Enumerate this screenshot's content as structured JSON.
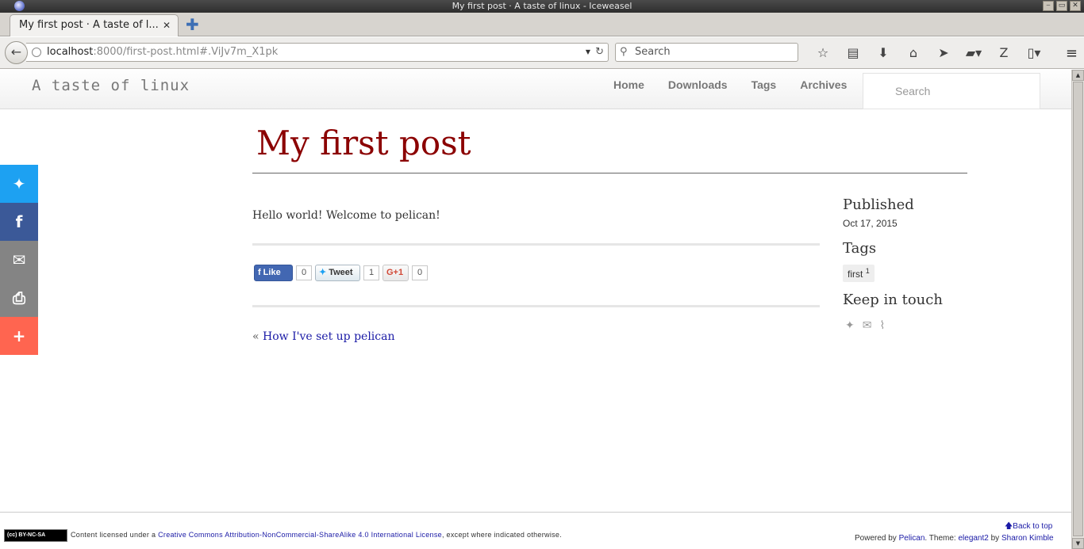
{
  "window": {
    "title": "My first post · A taste of linux - Iceweasel",
    "controls": [
      "⎯",
      "▭",
      "✕"
    ]
  },
  "tab": {
    "title": "My first post · A taste of l...",
    "close": "✕",
    "new_tab": "✚"
  },
  "nav": {
    "back": "←",
    "url_host": "localhost",
    "url_rest": ":8000/first-post.html#.ViJv7m_X1pk",
    "search_placeholder": "Search",
    "toolbar_icons": [
      "star-icon",
      "reading-list-icon",
      "download-icon",
      "home-icon",
      "send-icon",
      "folder-icon",
      "zotero-icon",
      "document-icon"
    ],
    "menu": "≡"
  },
  "site": {
    "brand": "A taste of linux",
    "nav": [
      "Home",
      "Downloads",
      "Tags",
      "Archives"
    ],
    "search_placeholder": "Search"
  },
  "post": {
    "title": "My first post",
    "body": "Hello world! Welcome to pelican!",
    "prev_label": "How I've set up pelican"
  },
  "share_buttons": {
    "like": "Like",
    "like_count": "0",
    "tweet": "Tweet",
    "tweet_count": "1",
    "gplus": "G+1",
    "gplus_count": "0"
  },
  "sidebar": {
    "published_heading": "Published",
    "published_date": "Oct 17, 2015",
    "tags_heading": "Tags",
    "tag": "first",
    "tag_count": "1",
    "keep_heading": "Keep in touch"
  },
  "share_bar": {
    "colors": [
      "#1da1f2",
      "#3b5998",
      "#848484",
      "#848484",
      "#ff6550"
    ],
    "icons": [
      "twitter-icon",
      "facebook-icon",
      "email-icon",
      "print-icon",
      "plus-icon"
    ]
  },
  "footer": {
    "cc_badge": "(cc) BY-NC-SA",
    "license_prefix": "Content licensed under a",
    "license_link": "Creative Commons Attribution-NonCommercial-ShareAlike 4.0 International License",
    "license_suffix": ", except where indicated otherwise.",
    "back_to_top": "Back to top",
    "powered_prefix": "Powered by",
    "pelican": "Pelican",
    "theme_prefix": ". Theme:",
    "theme": "elegant2",
    "by": "by",
    "author": "Sharon Kimble"
  }
}
